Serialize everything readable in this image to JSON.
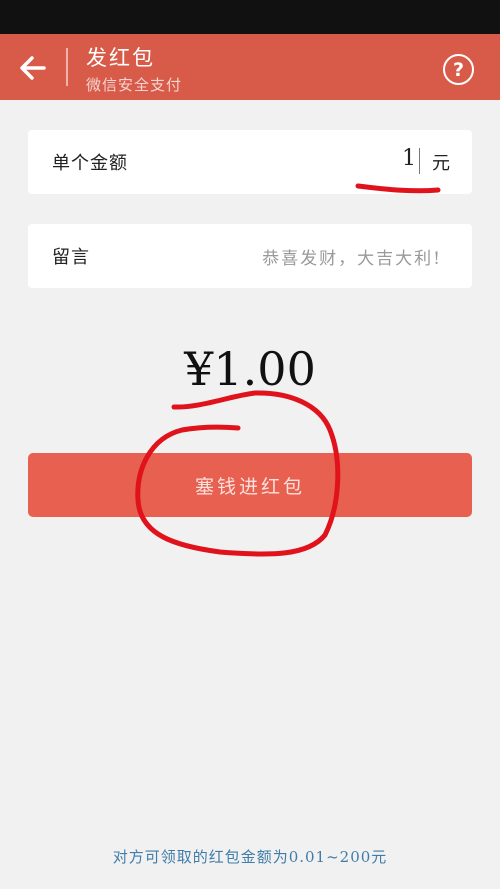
{
  "header": {
    "title": "发红包",
    "subtitle": "微信安全支付",
    "help_label": "?"
  },
  "amount_field": {
    "label": "单个金额",
    "value": "1",
    "unit": "元"
  },
  "message_field": {
    "label": "留言",
    "placeholder": "恭喜发财，大吉大利!"
  },
  "total": "¥1.00",
  "submit_label": "塞钱进红包",
  "footer_note": "对方可领取的红包金额为0.01~200元",
  "colors": {
    "header_bg": "#d85a48",
    "button_bg": "#e8604f",
    "annotation": "#e0121c",
    "footer_text": "#3f7ca8"
  }
}
